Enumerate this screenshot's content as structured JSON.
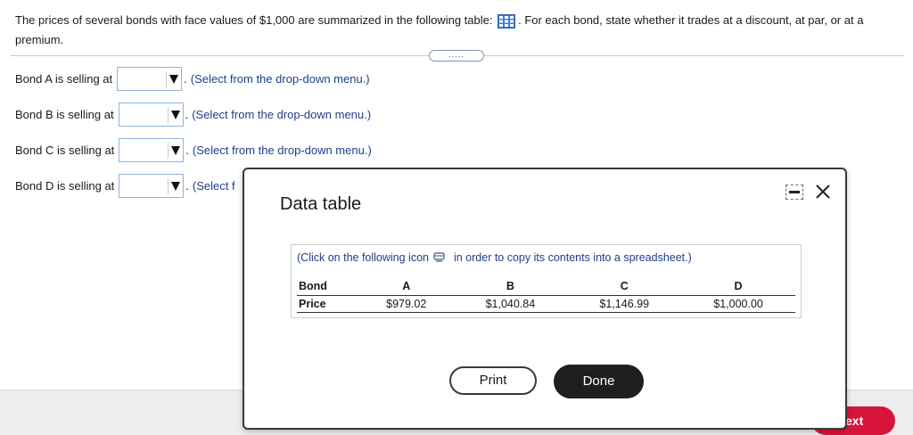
{
  "question": {
    "text_before": "The prices of several bonds with face values of $1,000 are summarized in the following table:",
    "text_after": ". For each bond, state whether it trades at a discount, at par, or at a premium."
  },
  "expander_label": ".....",
  "bond_rows": [
    {
      "label": "Bond A is selling at",
      "selected": "",
      "period": ".",
      "hint": "(Select from the drop-down menu.)"
    },
    {
      "label": "Bond B is selling at",
      "selected": "",
      "period": ".",
      "hint": "(Select from the drop-down menu.)"
    },
    {
      "label": "Bond C is selling at",
      "selected": "",
      "period": ".",
      "hint": "(Select from the drop-down menu.)"
    },
    {
      "label": "Bond D is selling at",
      "selected": "",
      "period": ".",
      "hint": "(Select f"
    }
  ],
  "modal": {
    "title": "Data table",
    "copy_hint_before": "(Click on the following icon",
    "copy_hint_after": "in order to copy its contents into a spreadsheet.)",
    "table": {
      "headers": [
        "Bond",
        "A",
        "B",
        "C",
        "D"
      ],
      "rows": [
        [
          "Price",
          "$979.02",
          "$1,040.84",
          "$1,146.99",
          "$1,000.00"
        ]
      ]
    },
    "print_label": "Print",
    "done_label": "Done"
  },
  "next_label": "ext"
}
